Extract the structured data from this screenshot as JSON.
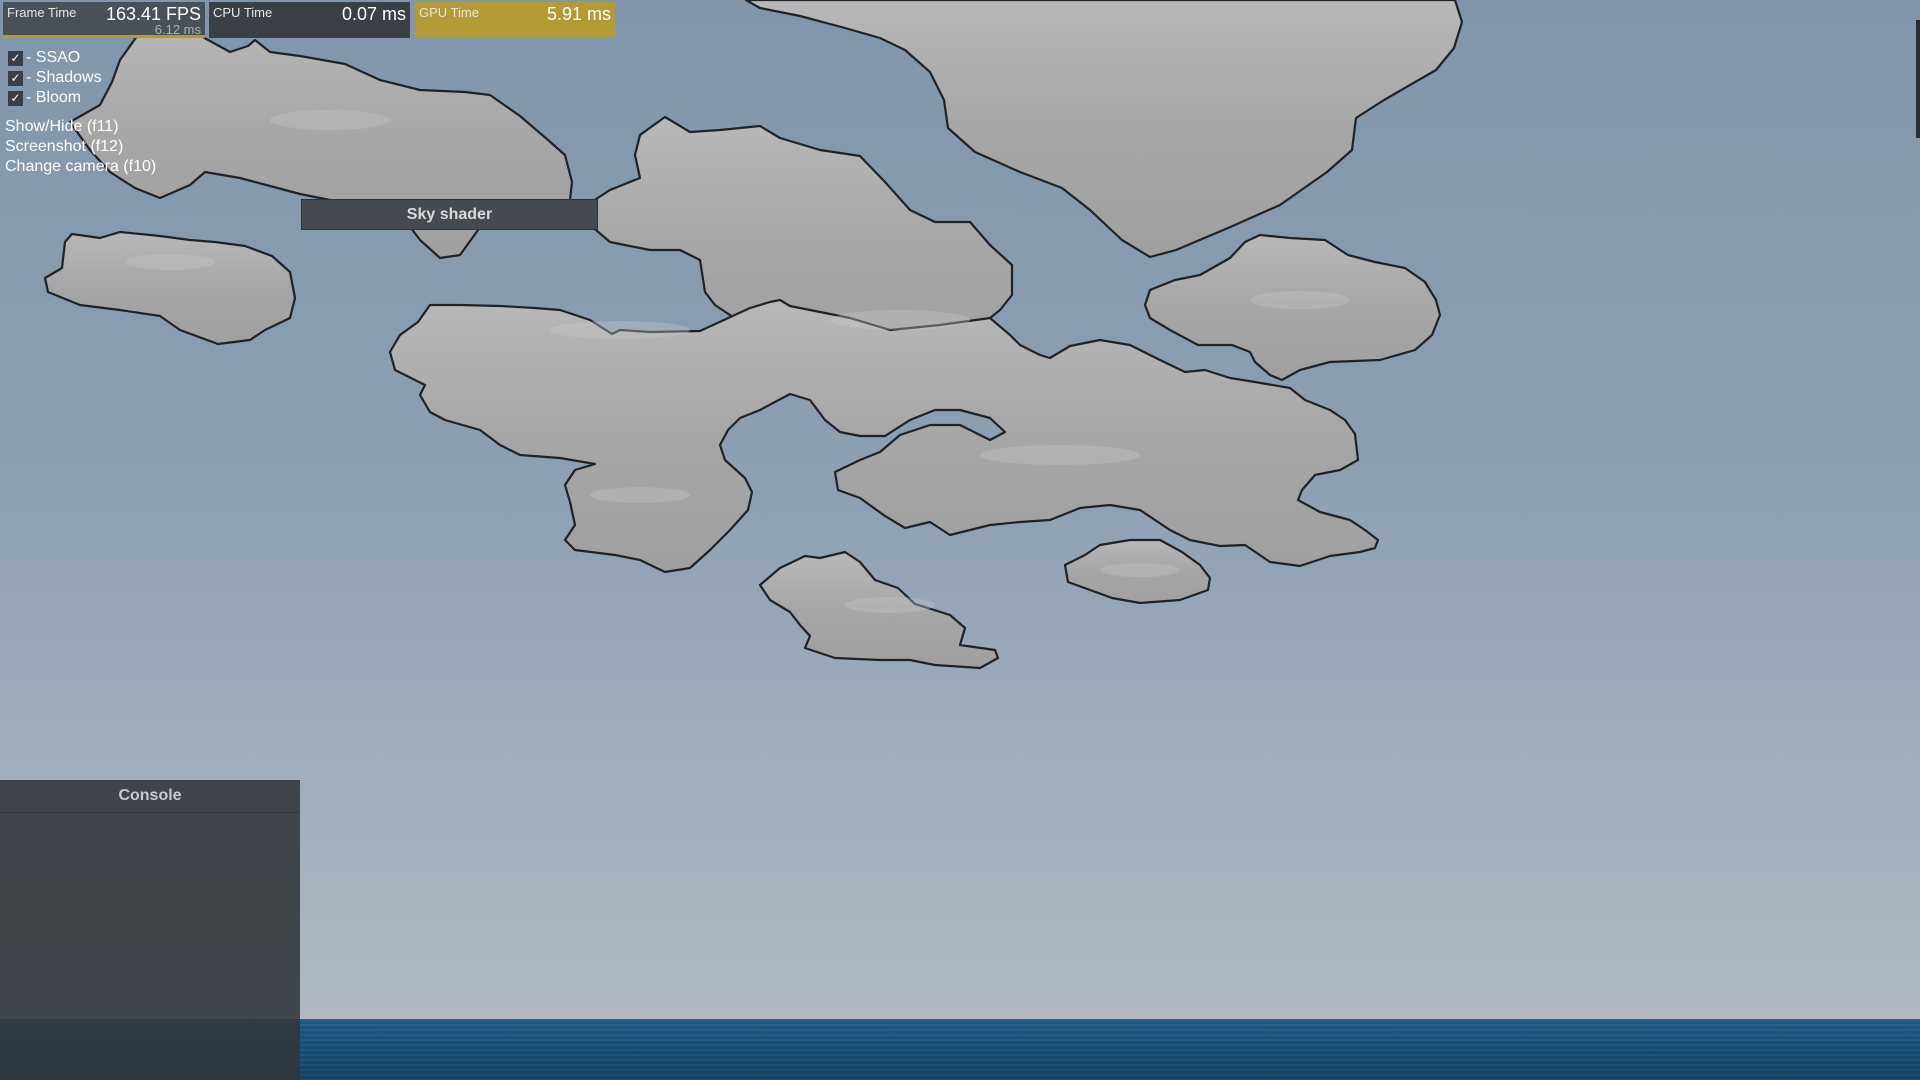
{
  "perf": {
    "frame": {
      "label": "Frame Time",
      "value": "163.41 FPS",
      "sub": "6.12 ms"
    },
    "cpu": {
      "label": "CPU Time",
      "value": "0.07 ms"
    },
    "gpu": {
      "label": "GPU Time",
      "value": "5.91 ms"
    }
  },
  "options": [
    {
      "label": "- SSAO",
      "checked": true
    },
    {
      "label": "- Shadows",
      "checked": true
    },
    {
      "label": "- Bloom",
      "checked": true
    }
  ],
  "hints": {
    "show_hide": "Show/Hide (f11)",
    "screenshot": "Screenshot (f12)",
    "change_camera": "Change camera (f10)"
  },
  "sky_shader": {
    "title": "Sky shader"
  },
  "console": {
    "title": "Console"
  },
  "colors": {
    "sky_top": "#8196ab",
    "sky_horizon": "#b4bcc3",
    "cloud": "#a4a4a4",
    "cloud_outline": "#222222",
    "sea": "#1d527b",
    "gpu_bar": "#b39a35",
    "panel": "#3b4046"
  }
}
